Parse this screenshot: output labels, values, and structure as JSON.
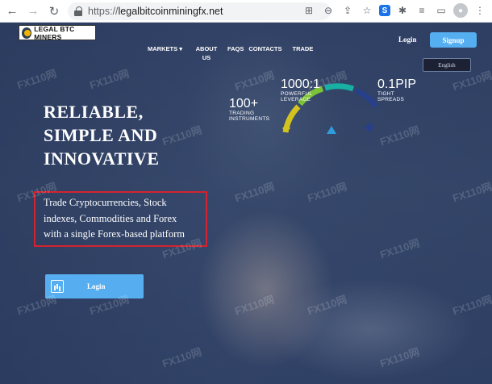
{
  "browser": {
    "url_scheme": "https://",
    "url_host": "legalbitcoinminingfx.net"
  },
  "site": {
    "logo_text": "LEGAL BTC MINERS",
    "menu": [
      "MARKETS",
      "ABOUT US",
      "FAQS",
      "CONTACTS",
      "TRADE"
    ],
    "login_label": "Login",
    "signup_label": "Signup",
    "language": "English"
  },
  "hero": {
    "headline": [
      "RELIABLE,",
      "SIMPLE AND",
      "INNOVATIVE"
    ],
    "subtitle": [
      "Trade Cryptocurrencies, Stock",
      "indexes, Commodities and Forex",
      "with a single Forex-based platform"
    ],
    "cta_label": "Login"
  },
  "stats": [
    {
      "value": "100+",
      "caption_1": "TRADING",
      "caption_2": "INSTRUMENTS",
      "color": "#d4c21e"
    },
    {
      "value": "1000:1",
      "caption_1": "POWERFUL",
      "caption_2": "LEVERAGE",
      "color": "#7cc436"
    },
    {
      "value": "0.1PIP",
      "caption_1": "TIGHT",
      "caption_2": "SPREADS",
      "color": "#2f9bd8"
    }
  ],
  "watermark": "FX110网",
  "colors": {
    "accent": "#56aef0",
    "highlight_border": "#d4232e",
    "gauge_teal": "#17b0a3",
    "gauge_navy": "#28408a"
  }
}
